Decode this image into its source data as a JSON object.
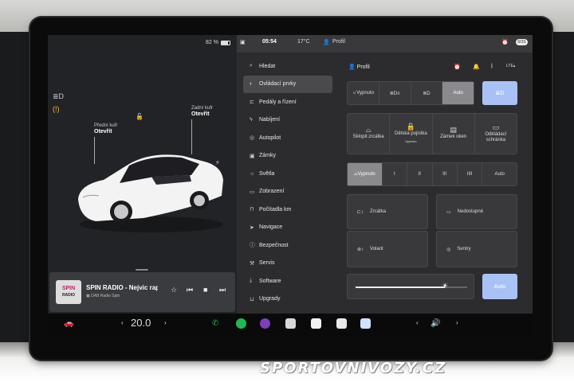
{
  "status": {
    "battery": "82 %",
    "time": "05:54",
    "temperature": "17°C",
    "profile": "Profil",
    "sos": "SOS"
  },
  "car": {
    "front_trunk": {
      "label": "Přední kufr",
      "action": "Otevřít"
    },
    "rear_trunk": {
      "label": "Zadní kufr",
      "action": "Otevřít"
    }
  },
  "player": {
    "logo_top": "SPIN",
    "logo_bottom": "RADIO",
    "station": "SPIN RADIO - Nejvic rap",
    "source": "DAB Radio Spin"
  },
  "menu": {
    "items": [
      {
        "label": "Hledat",
        "icon": "search-icon"
      },
      {
        "label": "Ovládací prvky",
        "icon": "toggle-icon"
      },
      {
        "label": "Pedály a řízení",
        "icon": "car-icon"
      },
      {
        "label": "Nabíjení",
        "icon": "bolt-icon"
      },
      {
        "label": "Autopilot",
        "icon": "steering-icon"
      },
      {
        "label": "Zámky",
        "icon": "lock-icon"
      },
      {
        "label": "Světla",
        "icon": "light-icon"
      },
      {
        "label": "Zobrazení",
        "icon": "display-icon"
      },
      {
        "label": "Počítadla km",
        "icon": "trip-icon"
      },
      {
        "label": "Navigace",
        "icon": "navigation-icon"
      },
      {
        "label": "Bezpečnost",
        "icon": "info-icon"
      },
      {
        "label": "Servis",
        "icon": "wrench-icon"
      },
      {
        "label": "Software",
        "icon": "download-icon"
      },
      {
        "label": "Upgrady",
        "icon": "bag-icon"
      }
    ],
    "active_index": 1
  },
  "content": {
    "profile_label": "Profil",
    "lights": {
      "off": "Vypnuto",
      "auto": "Auto"
    },
    "quick": [
      {
        "label": "Sklopit zrcátka",
        "sub": ""
      },
      {
        "label": "Dětská pojistka",
        "sub": "Vypnuto"
      },
      {
        "label": "Zámek oken",
        "sub": ""
      },
      {
        "label": "Odkládací schránka",
        "sub": ""
      }
    ],
    "wipers": {
      "off": "Vypnuto",
      "levels": [
        "I",
        "II",
        "III",
        "IIII"
      ],
      "auto": "Auto"
    },
    "cards": {
      "mirrors": "Zrcátka",
      "unavailable": "Nedostupné",
      "wheel": "Volant",
      "sentry": "Sentry"
    },
    "brightness": {
      "level": 0.8,
      "auto": "Auto"
    }
  },
  "dock": {
    "temperature": "20.0",
    "volume_icon": "volume-icon"
  },
  "watermark": "SPORTOVNIVOZY.CZ",
  "colors": {
    "accent_blue": "#a9c2f6",
    "alert_orange": "#f0a93a",
    "spotify_green": "#1db954"
  }
}
